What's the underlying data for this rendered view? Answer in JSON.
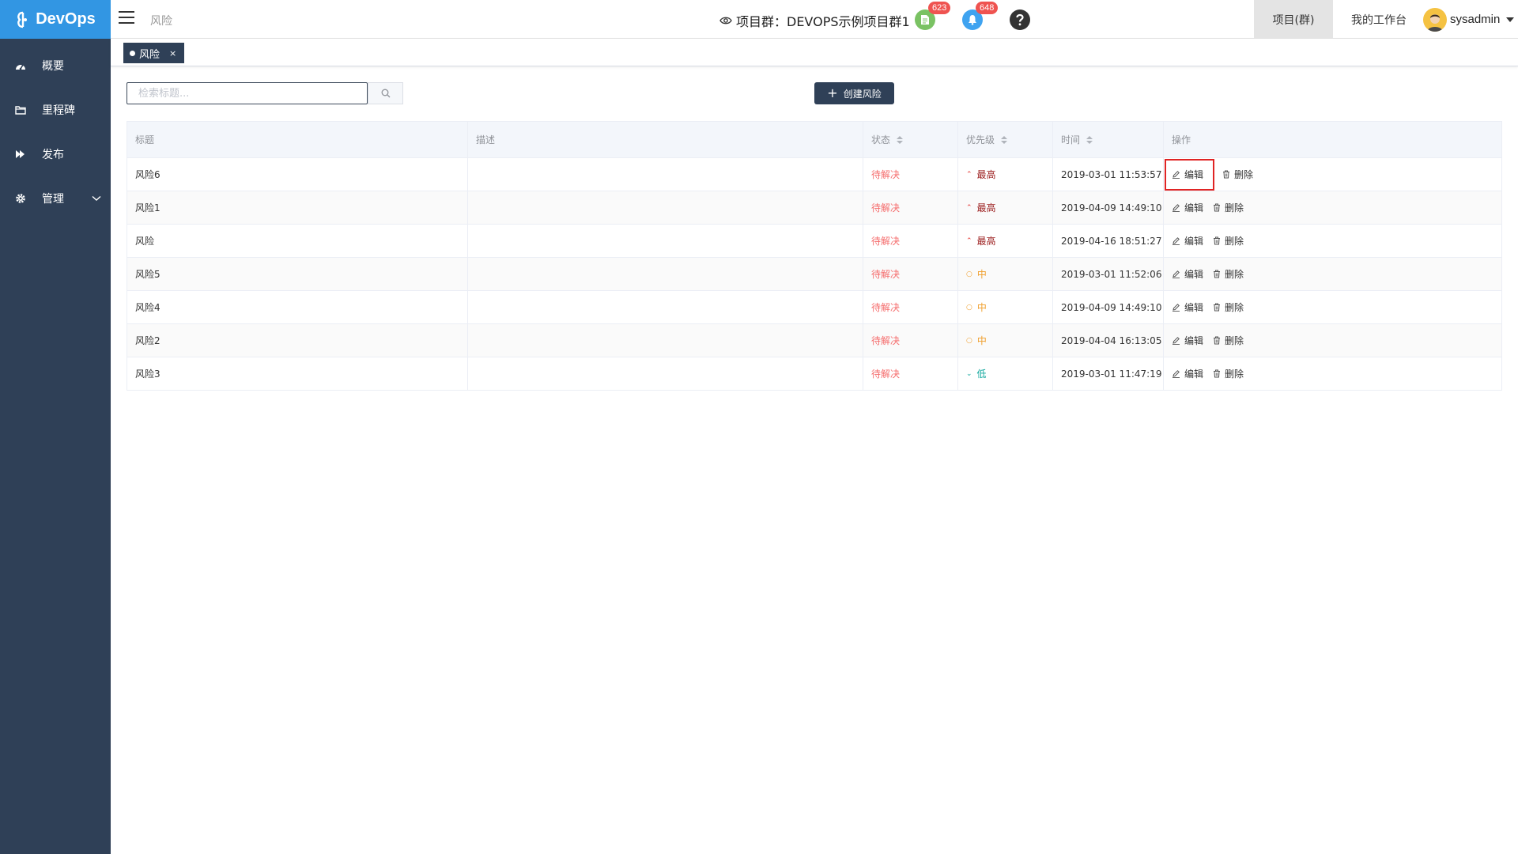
{
  "app": {
    "name": "DevOps"
  },
  "sidebar": {
    "items": [
      {
        "label": "概要",
        "icon": "dashboard-icon"
      },
      {
        "label": "里程碑",
        "icon": "folder-icon"
      },
      {
        "label": "发布",
        "icon": "forward-icon"
      },
      {
        "label": "管理",
        "icon": "gear-icon"
      }
    ]
  },
  "header": {
    "breadcrumb": "风险",
    "title": "项目群：DEVOPS示例项目群1",
    "doc_badge": "623",
    "bell_badge": "648",
    "help_icon": "question-icon",
    "tab_project": "项目(群)",
    "tab_workbench": "我的工作台",
    "username": "sysadmin"
  },
  "tags": {
    "active_tag": "风险",
    "close": "×"
  },
  "toolbar": {
    "search_placeholder": "检索标题...",
    "create_label": "创建风险"
  },
  "table": {
    "columns": [
      "标题",
      "描述",
      "状态",
      "优先级",
      "时间",
      "操作"
    ],
    "edit_label": "编辑",
    "delete_label": "删除",
    "rows": [
      {
        "title": "风险6",
        "desc": "",
        "status": "待解决",
        "priority": "最高",
        "level": "high",
        "time": "2019-03-01 11:53:57"
      },
      {
        "title": "风险1",
        "desc": "",
        "status": "待解决",
        "priority": "最高",
        "level": "high",
        "time": "2019-04-09 14:49:10"
      },
      {
        "title": "风险",
        "desc": "",
        "status": "待解决",
        "priority": "最高",
        "level": "high",
        "time": "2019-04-16 18:51:27"
      },
      {
        "title": "风险5",
        "desc": "",
        "status": "待解决",
        "priority": "中",
        "level": "mid",
        "time": "2019-03-01 11:52:06"
      },
      {
        "title": "风险4",
        "desc": "",
        "status": "待解决",
        "priority": "中",
        "level": "mid",
        "time": "2019-04-09 14:49:10"
      },
      {
        "title": "风险2",
        "desc": "",
        "status": "待解决",
        "priority": "中",
        "level": "mid",
        "time": "2019-04-04 16:13:05"
      },
      {
        "title": "风险3",
        "desc": "",
        "status": "待解决",
        "priority": "低",
        "level": "low",
        "time": "2019-03-01 11:47:19"
      }
    ]
  },
  "colors": {
    "sidebar_bg": "#2f4057",
    "logo_bg": "#3296e3",
    "status_red": "#f56c6c",
    "priority_high": "#9b1c1c",
    "priority_mid": "#f0a02f",
    "priority_low": "#13a89e",
    "highlight_box": "#e02424"
  }
}
